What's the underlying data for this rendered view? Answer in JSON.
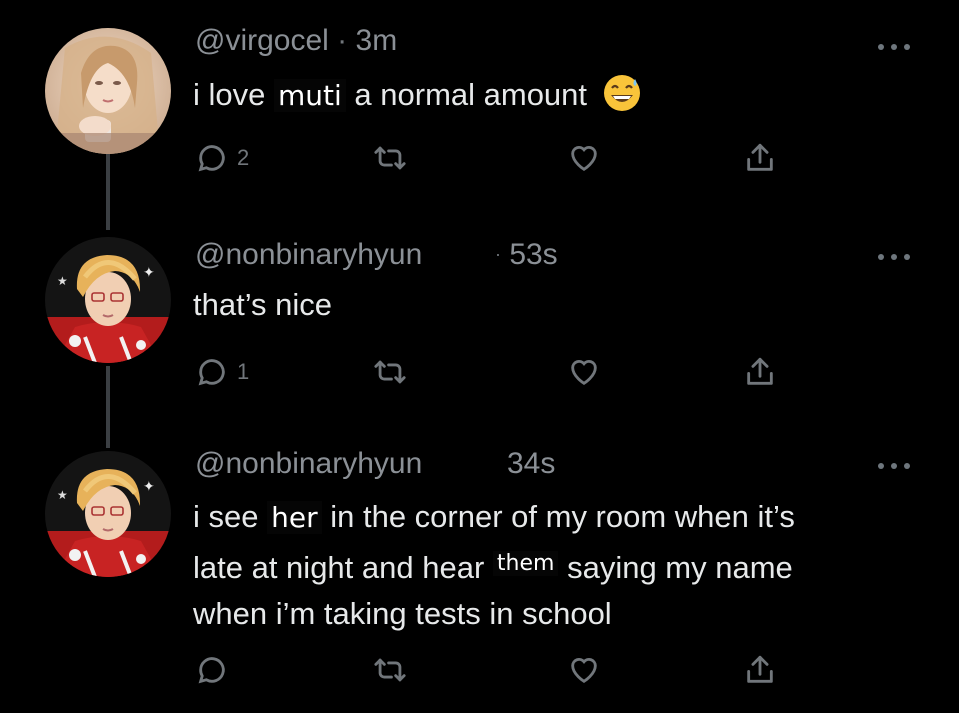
{
  "tweets": [
    {
      "handle": "@virgocel",
      "separator": "·",
      "time": "3m",
      "text_before": "i love",
      "inserted": "muti",
      "text_after": "a normal amount",
      "emoji": "grinning-sweat-emoji",
      "replies": "2",
      "avatar": "avatar-virgocel"
    },
    {
      "handle": "@nonbinaryhyun",
      "separator": "·",
      "time": "53s",
      "text": "that’s nice",
      "replies": "1",
      "avatar": "avatar-nonbinaryhyun"
    },
    {
      "handle": "@nonbinaryhyun",
      "time": "34s",
      "line1_before": "i see",
      "inserted1": "her",
      "line1_after": "in the corner of my room when it’s",
      "line2_before": "late at night and hear",
      "inserted2": "them",
      "line2_after": "saying my name",
      "line3": "when i’m taking tests in school",
      "avatar": "avatar-nonbinaryhyun"
    }
  ],
  "icons": {
    "reply": "reply-icon",
    "retweet": "retweet-icon",
    "like": "heart-icon",
    "share": "share-icon",
    "more": "more-icon"
  },
  "colors": {
    "background": "#000000",
    "text": "#e7e9ea",
    "muted": "#71767b",
    "thread_line": "#3b3f43"
  }
}
